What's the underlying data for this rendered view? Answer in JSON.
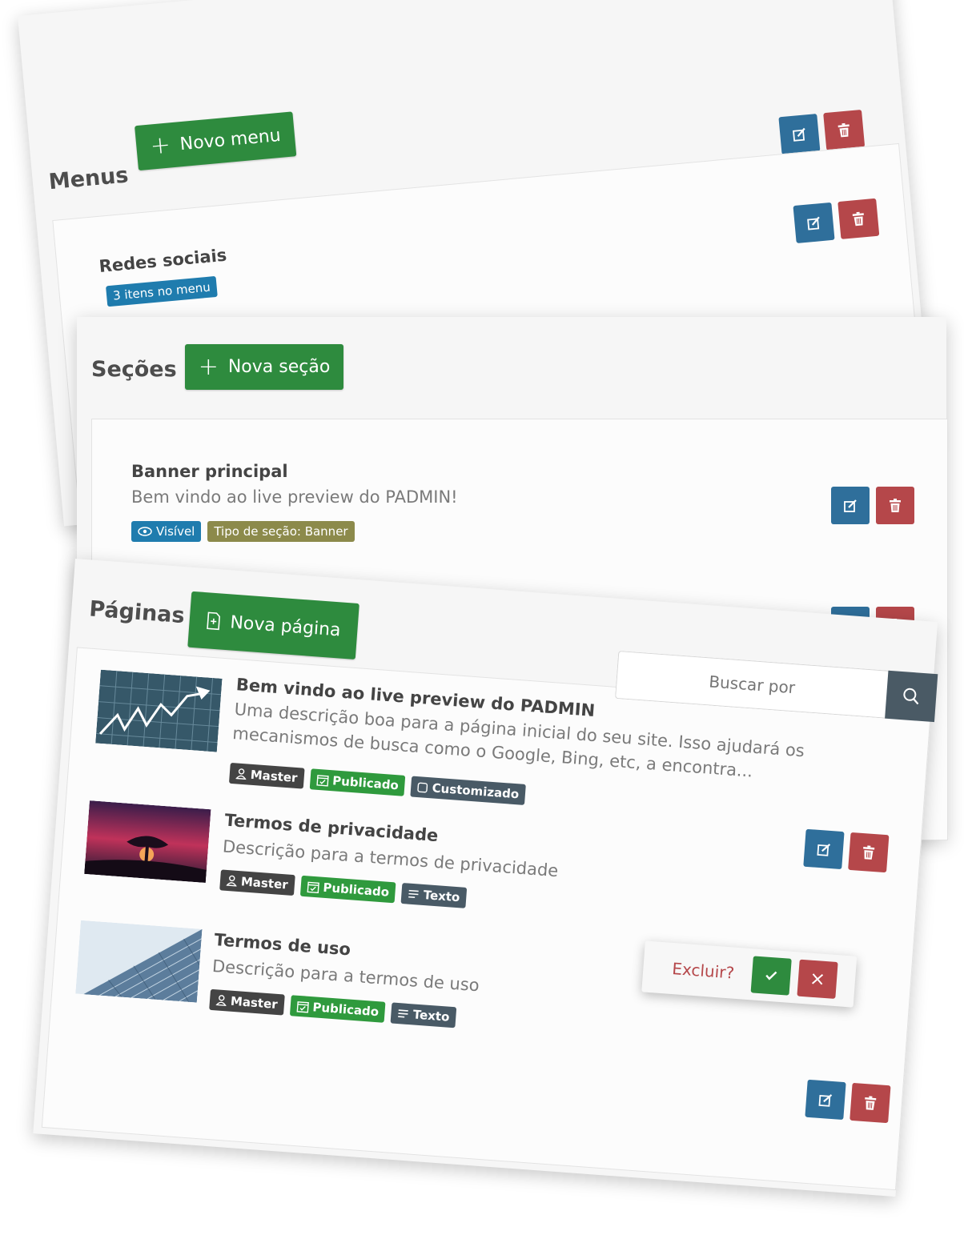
{
  "menus": {
    "title": "Menus",
    "new_button": "Novo menu",
    "items": [
      {
        "title": "Redes sociais",
        "badge": "3 itens no menu"
      }
    ]
  },
  "secoes": {
    "title": "Seções",
    "new_button": "Nova seção",
    "items": [
      {
        "title": "Banner principal",
        "description": "Bem vindo ao live preview do PADMIN!",
        "visible_badge": "Visível",
        "type_badge": "Tipo de seção: Banner"
      }
    ]
  },
  "paginas": {
    "title": "Páginas",
    "new_button": "Nova página",
    "search_placeholder": "Buscar por",
    "items": [
      {
        "title": "Bem vindo ao live preview do PADMIN",
        "description": "Uma descrição boa para a página inicial do seu site. Isso ajudará os mecanismos de busca como o Google, Bing, etc, a encontra...",
        "badges": [
          "Master",
          "Publicado",
          "Customizado"
        ]
      },
      {
        "title": "Termos de privacidade",
        "description": "Descrição para a termos de privacidade",
        "badges": [
          "Master",
          "Publicado",
          "Texto"
        ]
      },
      {
        "title": "Termos de uso",
        "description": "Descrição para a termos de uso",
        "badges": [
          "Master",
          "Publicado",
          "Texto"
        ]
      }
    ],
    "confirm": {
      "label": "Excluir?"
    }
  },
  "colors": {
    "primary_green": "#2e8b3e",
    "edit_blue": "#2f6f9b",
    "delete_red": "#b5474a",
    "info_blue": "#1f7cae",
    "olive": "#8c8a4b",
    "dark": "#444444",
    "slate": "#495a66"
  },
  "icons": [
    "plus-icon",
    "edit-icon",
    "trash-icon",
    "eye-icon",
    "file-plus-icon",
    "search-icon",
    "user-icon",
    "calendar-check-icon",
    "square-icon",
    "text-lines-icon",
    "check-icon",
    "close-icon"
  ]
}
